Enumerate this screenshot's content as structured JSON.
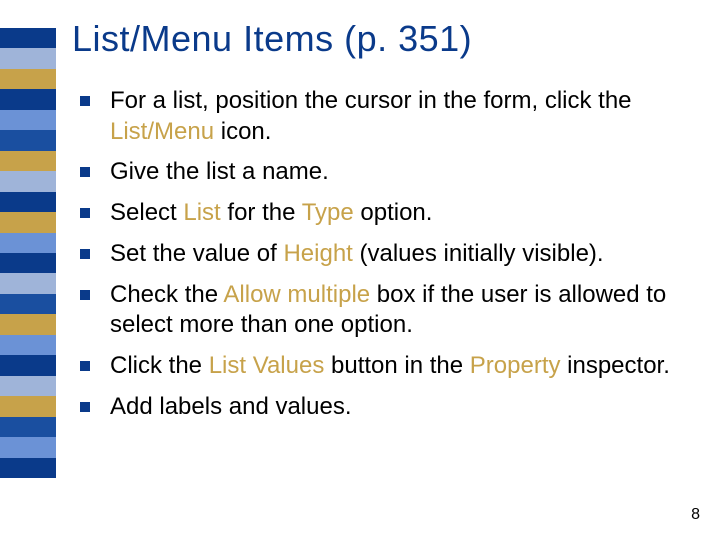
{
  "title": "List/Menu Items (p. 351)",
  "page_number": "8",
  "bullets": [
    {
      "pre": "For a list, position the cursor in the form, click the ",
      "hl": "List/Menu",
      "post": " icon."
    },
    {
      "pre": "Give the list a name.",
      "hl": "",
      "post": ""
    },
    {
      "pre": "Select ",
      "hl": "List",
      "post_pre": " for the ",
      "hl2": "Type",
      "post": " option."
    },
    {
      "pre": "Set the value of ",
      "hl": "Height",
      "post": " (values initially visible)."
    },
    {
      "pre": "Check the ",
      "hl": "Allow multiple",
      "post": " box if the user is allowed to select more than one option."
    },
    {
      "pre": "Click the ",
      "hl": "List Values",
      "post_pre": " button in the ",
      "hl2": "Property",
      "post": " inspector."
    },
    {
      "pre": "Add labels and values.",
      "hl": "",
      "post": ""
    }
  ]
}
